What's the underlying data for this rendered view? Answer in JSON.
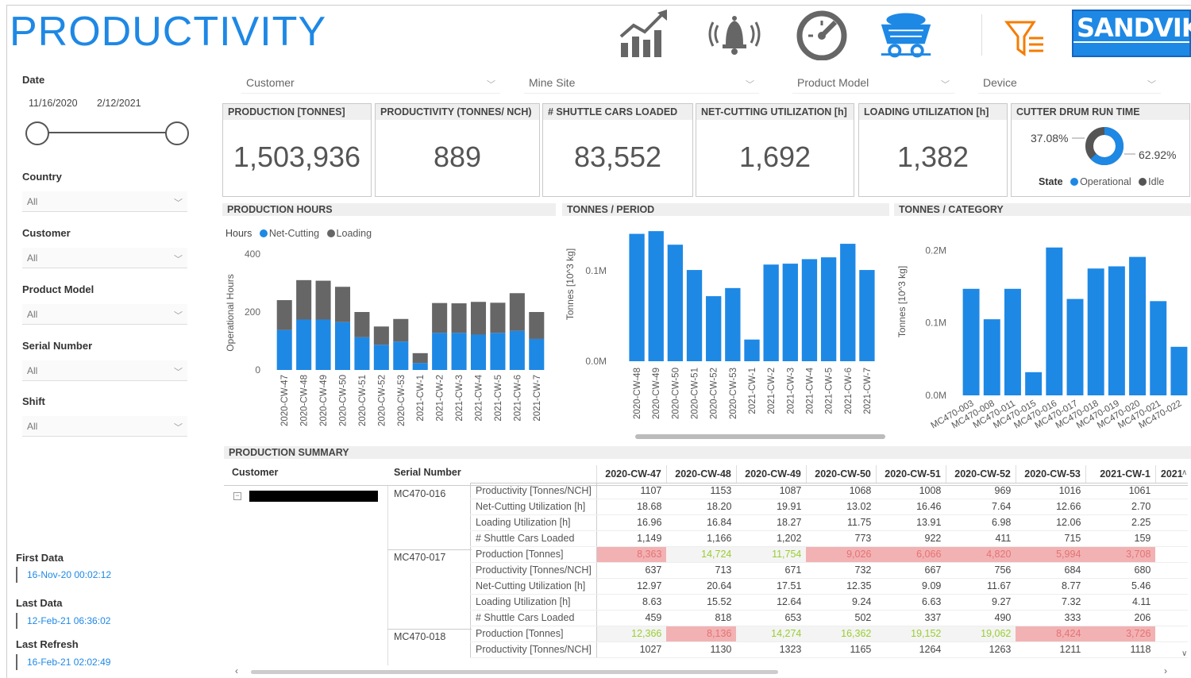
{
  "header": {
    "title": "PRODUCTIVITY",
    "brand": "SANDVIK",
    "icons": [
      "chart-growth-icon",
      "alarm-bell-icon",
      "gauge-icon",
      "mine-cart-icon",
      "filter-clear-icon"
    ],
    "accent": "#1e88e5"
  },
  "left_panel": {
    "date_label": "Date",
    "date_from": "11/16/2020",
    "date_to": "2/12/2021",
    "filters": [
      {
        "label": "Country",
        "value": "All"
      },
      {
        "label": "Customer",
        "value": "All"
      },
      {
        "label": "Product Model",
        "value": "All"
      },
      {
        "label": "Serial Number",
        "value": "All"
      },
      {
        "label": "Shift",
        "value": "All"
      }
    ],
    "first_data_label": "First Data",
    "first_data": "16-Nov-20 00:02:12",
    "last_data_label": "Last Data",
    "last_data": "12-Feb-21 06:36:02",
    "last_refresh_label": "Last Refresh",
    "last_refresh": "16-Feb-21 02:02:49"
  },
  "top_filters": [
    {
      "label": "Customer"
    },
    {
      "label": "Mine Site"
    },
    {
      "label": "Product Model"
    },
    {
      "label": "Device"
    }
  ],
  "kpis": [
    {
      "title": "PRODUCTION [TONNES]",
      "value": "1,503,936"
    },
    {
      "title": "PRODUCTIVITY (TONNES/ NCH)",
      "value": "889"
    },
    {
      "title": "# SHUTTLE CARS LOADED",
      "value": "83,552"
    },
    {
      "title": "NET-CUTTING UTILIZATION [h]",
      "value": "1,692"
    },
    {
      "title": "LOADING UTILIZATION [h]",
      "value": "1,382"
    }
  ],
  "drum": {
    "title": "CUTTER DRUM RUN TIME",
    "idle_pct": "37.08%",
    "operational_pct": "62.92%",
    "state_label": "State",
    "legend_operational": "Operational",
    "legend_idle": "Idle",
    "operational_color": "#1e88e5",
    "idle_color": "#555555"
  },
  "sections": {
    "production_hours": "PRODUCTION HOURS",
    "tonnes_period": "TONNES / PERIOD",
    "tonnes_category": "TONNES / CATEGORY",
    "production_summary": "PRODUCTION SUMMARY"
  },
  "chart_data": [
    {
      "type": "bar",
      "stacked": true,
      "legend_title": "Hours",
      "ylabel": "Operational Hours",
      "ylim": [
        0,
        400
      ],
      "yticks": [
        "0",
        "200",
        "400"
      ],
      "categories": [
        "2020-CW-47",
        "2020-CW-48",
        "2020-CW-49",
        "2020-CW-50",
        "2020-CW-51",
        "2020-CW-52",
        "2020-CW-53",
        "2021-CW-1",
        "2021-CW-2",
        "2021-CW-3",
        "2021-CW-4",
        "2021-CW-5",
        "2021-CW-6",
        "2021-CW-7"
      ],
      "series": [
        {
          "name": "Net-Cutting",
          "color": "#1e88e5",
          "values": [
            138,
            174,
            174,
            165,
            113,
            87,
            98,
            24,
            128,
            128,
            122,
            128,
            135,
            107
          ]
        },
        {
          "name": "Loading",
          "color": "#666666",
          "values": [
            103,
            136,
            134,
            122,
            87,
            63,
            78,
            34,
            103,
            102,
            113,
            104,
            130,
            93
          ]
        }
      ]
    },
    {
      "type": "bar",
      "ylabel": "Tonnes [10^3 kg]",
      "ylim": [
        0,
        0.145
      ],
      "yticks": [
        "0.0M",
        "0.1M"
      ],
      "color": "#1e88e5",
      "categories": [
        "2020-CW-48",
        "2020-CW-49",
        "2020-CW-50",
        "2020-CW-51",
        "2020-CW-52",
        "2020-CW-53",
        "2021-CW-1",
        "2021-CW-2",
        "2021-CW-3",
        "2021-CW-4",
        "2021-CW-5",
        "2021-CW-6",
        "2021-CW-7"
      ],
      "values": [
        0.141,
        0.144,
        0.129,
        0.101,
        0.072,
        0.081,
        0.024,
        0.107,
        0.108,
        0.113,
        0.115,
        0.13,
        0.101
      ]
    },
    {
      "type": "bar",
      "ylabel": "Tonnes [10^3 kg]",
      "ylim": [
        0,
        0.23
      ],
      "yticks": [
        "0.0M",
        "0.1M",
        "0.2M"
      ],
      "color": "#1e88e5",
      "categories": [
        "MC470-003",
        "MC470-008",
        "MC470-011",
        "MC470-015",
        "MC470-016",
        "MC470-017",
        "MC470-018",
        "MC470-019",
        "MC470-020",
        "MC470-021",
        "MC470-022"
      ],
      "values": [
        0.147,
        0.105,
        0.147,
        0.032,
        0.204,
        0.133,
        0.175,
        0.178,
        0.191,
        0.13,
        0.067
      ]
    }
  ],
  "summary": {
    "col_customer": "Customer",
    "col_serial": "Serial Number",
    "weeks": [
      "2020-CW-47",
      "2020-CW-48",
      "2020-CW-49",
      "2020-CW-50",
      "2020-CW-51",
      "2020-CW-52",
      "2020-CW-53",
      "2021-CW-1",
      "2021"
    ],
    "rows": [
      {
        "serial": "MC470-016",
        "metric": "Productivity [Tonnes/NCH]",
        "vals": [
          "1107",
          "1153",
          "1087",
          "1068",
          "1008",
          "969",
          "1016",
          "1061"
        ],
        "hl": []
      },
      {
        "serial": "",
        "metric": "Net-Cutting Utilization [h]",
        "vals": [
          "18.68",
          "18.20",
          "19.91",
          "13.02",
          "16.46",
          "7.64",
          "12.66",
          "2.70"
        ],
        "hl": []
      },
      {
        "serial": "",
        "metric": "Loading Utilization [h]",
        "vals": [
          "16.96",
          "16.84",
          "18.27",
          "11.75",
          "13.91",
          "6.98",
          "12.06",
          "2.25"
        ],
        "hl": []
      },
      {
        "serial": "",
        "metric": "# Shuttle Cars Loaded",
        "vals": [
          "1,149",
          "1,166",
          "1,202",
          "773",
          "922",
          "411",
          "715",
          "159"
        ],
        "hl": []
      },
      {
        "serial": "MC470-017",
        "metric": "Production [Tonnes]",
        "vals": [
          "8,363",
          "14,724",
          "11,754",
          "9,026",
          "6,066",
          "4,820",
          "5,994",
          "3,708"
        ],
        "hl": [
          "r",
          "g",
          "g",
          "r",
          "r",
          "r",
          "r",
          "r"
        ]
      },
      {
        "serial": "",
        "metric": "Productivity [Tonnes/NCH]",
        "vals": [
          "637",
          "713",
          "671",
          "732",
          "667",
          "756",
          "684",
          "680"
        ],
        "hl": []
      },
      {
        "serial": "",
        "metric": "Net-Cutting Utilization [h]",
        "vals": [
          "12.97",
          "20.64",
          "17.51",
          "12.35",
          "9.09",
          "11.67",
          "8.77",
          "5.46"
        ],
        "hl": []
      },
      {
        "serial": "",
        "metric": "Loading Utilization [h]",
        "vals": [
          "8.63",
          "15.52",
          "12.64",
          "9.24",
          "6.63",
          "9.27",
          "7.32",
          "4.11"
        ],
        "hl": []
      },
      {
        "serial": "",
        "metric": "# Shuttle Cars Loaded",
        "vals": [
          "459",
          "818",
          "653",
          "502",
          "337",
          "490",
          "333",
          "206"
        ],
        "hl": []
      },
      {
        "serial": "MC470-018",
        "metric": "Production [Tonnes]",
        "vals": [
          "12,366",
          "8,136",
          "14,274",
          "16,362",
          "19,152",
          "19,062",
          "8,424",
          "3,726"
        ],
        "hl": [
          "g",
          "r",
          "g",
          "g",
          "g",
          "g",
          "r",
          "r"
        ]
      },
      {
        "serial": "",
        "metric": "Productivity [Tonnes/NCH]",
        "vals": [
          "1027",
          "1130",
          "1323",
          "1165",
          "1264",
          "1263",
          "1211",
          "1118"
        ],
        "hl": []
      }
    ]
  }
}
